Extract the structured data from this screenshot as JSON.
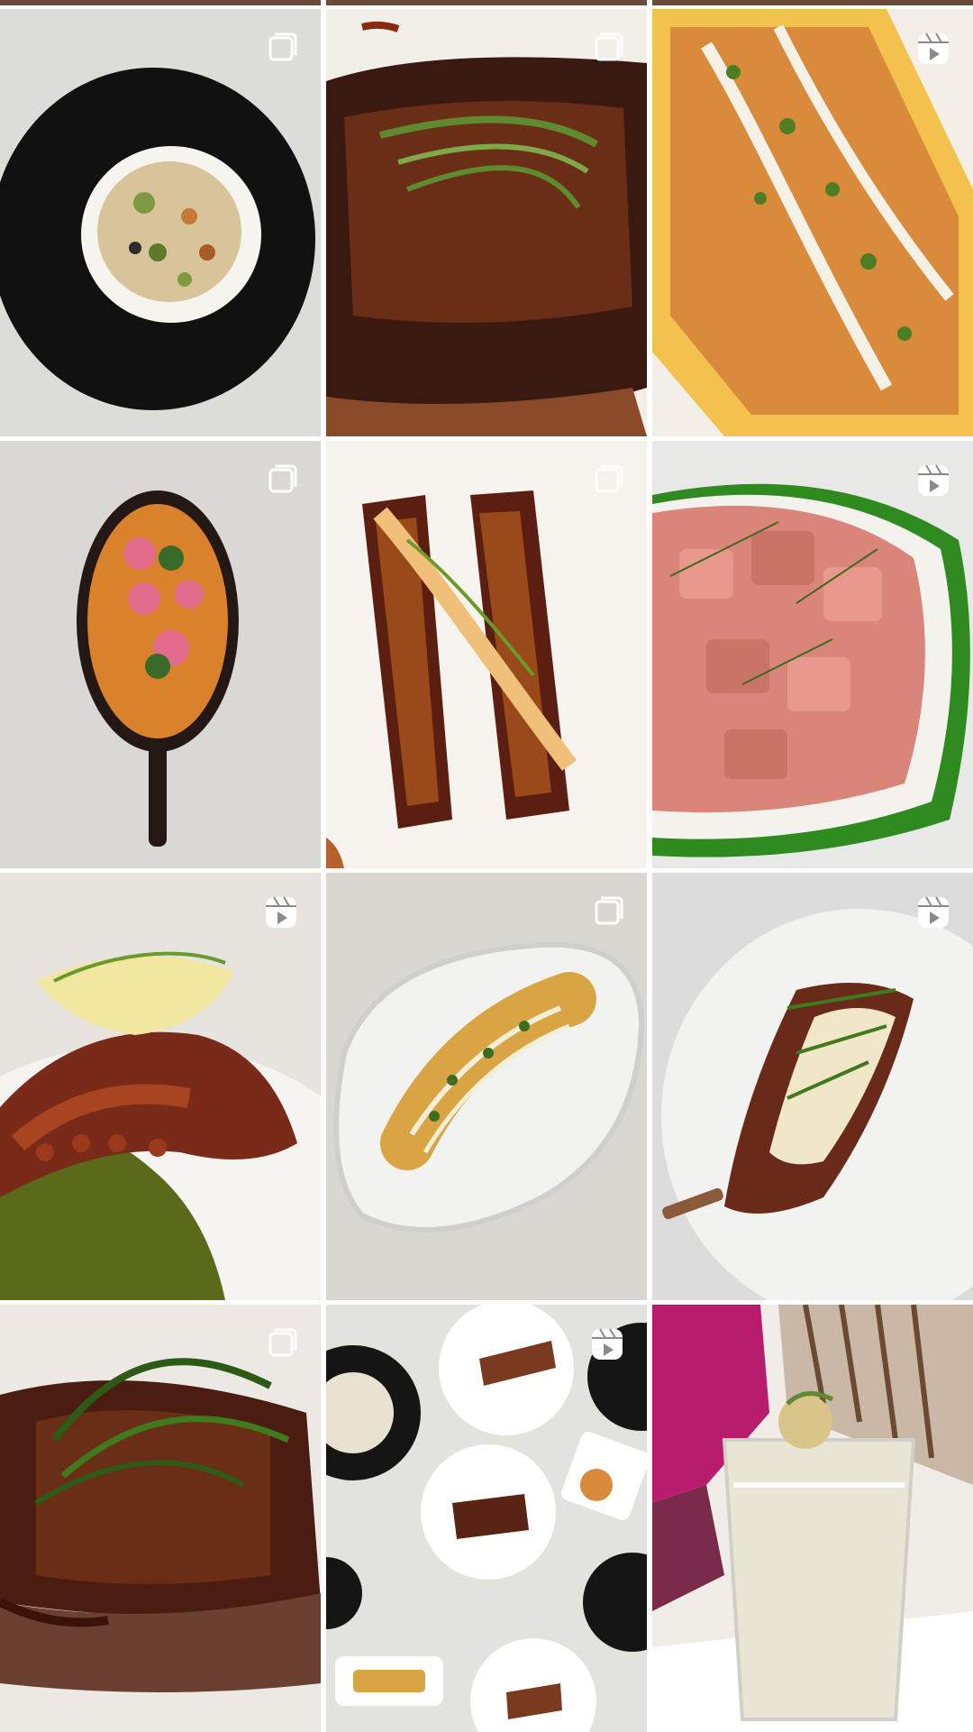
{
  "screen": "profile-photo-grid",
  "icons": {
    "carousel": "multiple-posts-icon",
    "reel": "reels-play-icon"
  },
  "posts": [
    {
      "type": "carousel",
      "subject": "plated-cauliflower-dish",
      "colors": [
        "#dfdfdc",
        "#151515",
        "#f3efe5",
        "#c98a42"
      ]
    },
    {
      "type": "carousel",
      "subject": "glazed-short-rib",
      "colors": [
        "#f3efe9",
        "#3a1a10",
        "#6a2d15",
        "#5f8a2f"
      ]
    },
    {
      "type": "reel",
      "subject": "grilled-corn-with-crumbs",
      "colors": [
        "#f2c14e",
        "#d98a3a",
        "#4f7d24",
        "#f5f1e6"
      ]
    },
    {
      "type": "carousel",
      "subject": "cast-iron-skillet-rice",
      "colors": [
        "#d9d8d4",
        "#241815",
        "#d9822b",
        "#e26b8c"
      ]
    },
    {
      "type": "carousel",
      "subject": "glazed-eggplant",
      "colors": [
        "#f6f3ef",
        "#5a1f10",
        "#9a4a1a",
        "#f0c07a"
      ]
    },
    {
      "type": "reel",
      "subject": "tuna-tartare",
      "colors": [
        "#e8e8e6",
        "#d9857a",
        "#f4f2ec",
        "#2f8a1f"
      ]
    },
    {
      "type": "reel",
      "subject": "grilled-octopus",
      "colors": [
        "#e7e4df",
        "#7a2a18",
        "#5a6a1a",
        "#f2e7a0"
      ]
    },
    {
      "type": "carousel",
      "subject": "corn-on-oval-plate",
      "colors": [
        "#d9d7d2",
        "#f2f2f0",
        "#d9a544",
        "#3f6d1f"
      ]
    },
    {
      "type": "reel",
      "subject": "pork-chop",
      "colors": [
        "#dcdcdc",
        "#f2f2f0",
        "#6a2a1a",
        "#f0e6c8"
      ]
    },
    {
      "type": "carousel",
      "subject": "short-rib-close-up",
      "colors": [
        "#ece9e4",
        "#4a1d10",
        "#2d5a16",
        "#6a4030"
      ]
    },
    {
      "type": "reel",
      "subject": "table-spread",
      "colors": [
        "#e2e2df",
        "#ffffff",
        "#151515",
        "#7a3a20"
      ]
    },
    {
      "type": "reel",
      "subject": "cocktail-with-flowers",
      "colors": [
        "#b81d6d",
        "#e9e6d5",
        "#ffffff",
        "#6a4a30"
      ]
    }
  ]
}
